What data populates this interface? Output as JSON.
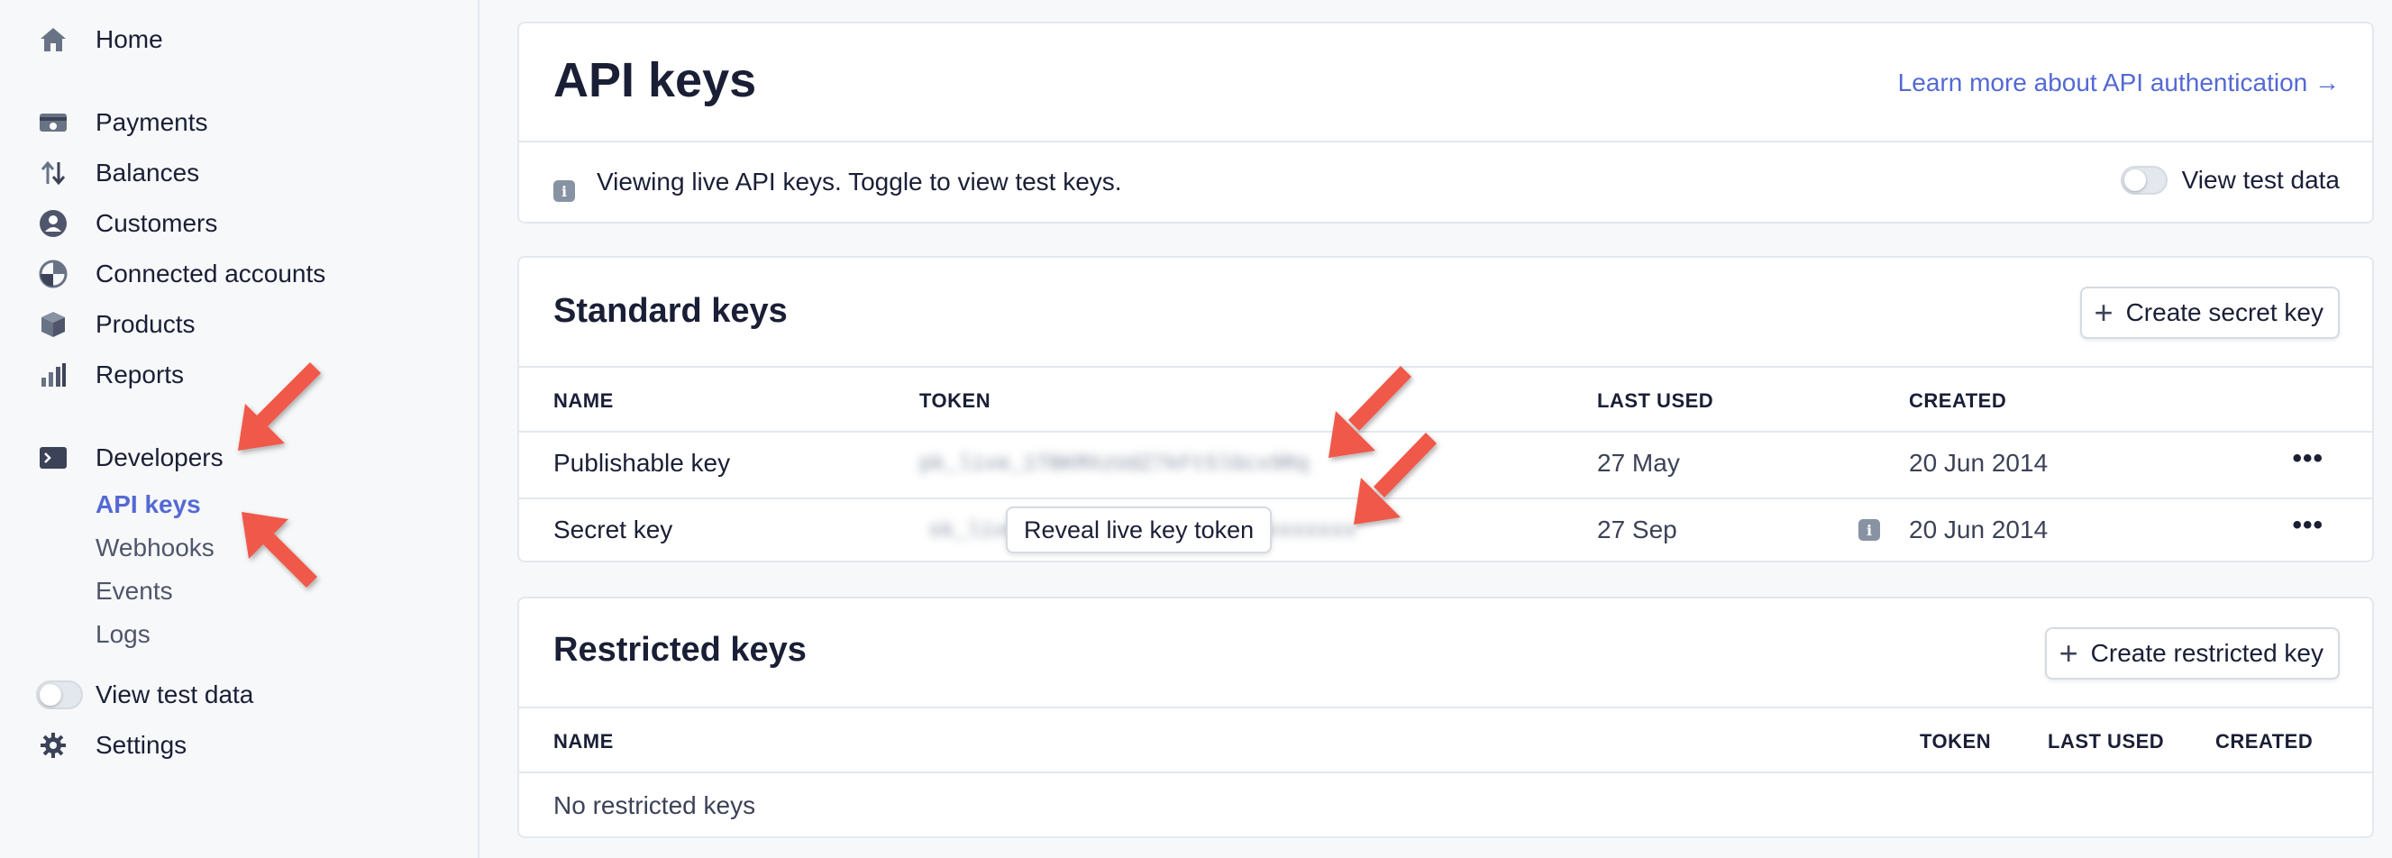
{
  "sidebar": {
    "home": "Home",
    "payments": "Payments",
    "balances": "Balances",
    "customers": "Customers",
    "connected_accounts": "Connected accounts",
    "products": "Products",
    "reports": "Reports",
    "developers": "Developers",
    "sub_items": {
      "api_keys": "API keys",
      "webhooks": "Webhooks",
      "events": "Events",
      "logs": "Logs"
    },
    "view_test_data": "View test data",
    "settings": "Settings"
  },
  "header": {
    "title": "API keys",
    "learn_more": "Learn more about API authentication →",
    "notice": "Viewing live API keys. Toggle to view test keys.",
    "view_test_data": "View test data"
  },
  "standard_keys": {
    "title": "Standard keys",
    "create_button": "Create secret key",
    "columns": {
      "name": "NAME",
      "token": "TOKEN",
      "last_used": "LAST USED",
      "created": "CREATED"
    },
    "rows": [
      {
        "name": "Publishable key",
        "token": "pk_live_1TBKMXzUdZ7kFt5lGcx9Rq",
        "last_used": "27 May",
        "created": "20 Jun 2014"
      },
      {
        "name": "Secret key",
        "token": "sk_live_xxxxxxxxxxxxxxxxxxxxxxxxx",
        "reveal": "Reveal live key token",
        "last_used": "27 Sep",
        "created": "20 Jun 2014"
      }
    ],
    "more": "•••"
  },
  "restricted_keys": {
    "title": "Restricted keys",
    "create_button": "Create restricted key",
    "columns": {
      "name": "NAME",
      "token": "TOKEN",
      "last_used": "LAST USED",
      "created": "CREATED"
    },
    "empty": "No restricted keys"
  },
  "colors": {
    "accent": "#5469d4",
    "annotation_arrow": "#f0594a"
  }
}
